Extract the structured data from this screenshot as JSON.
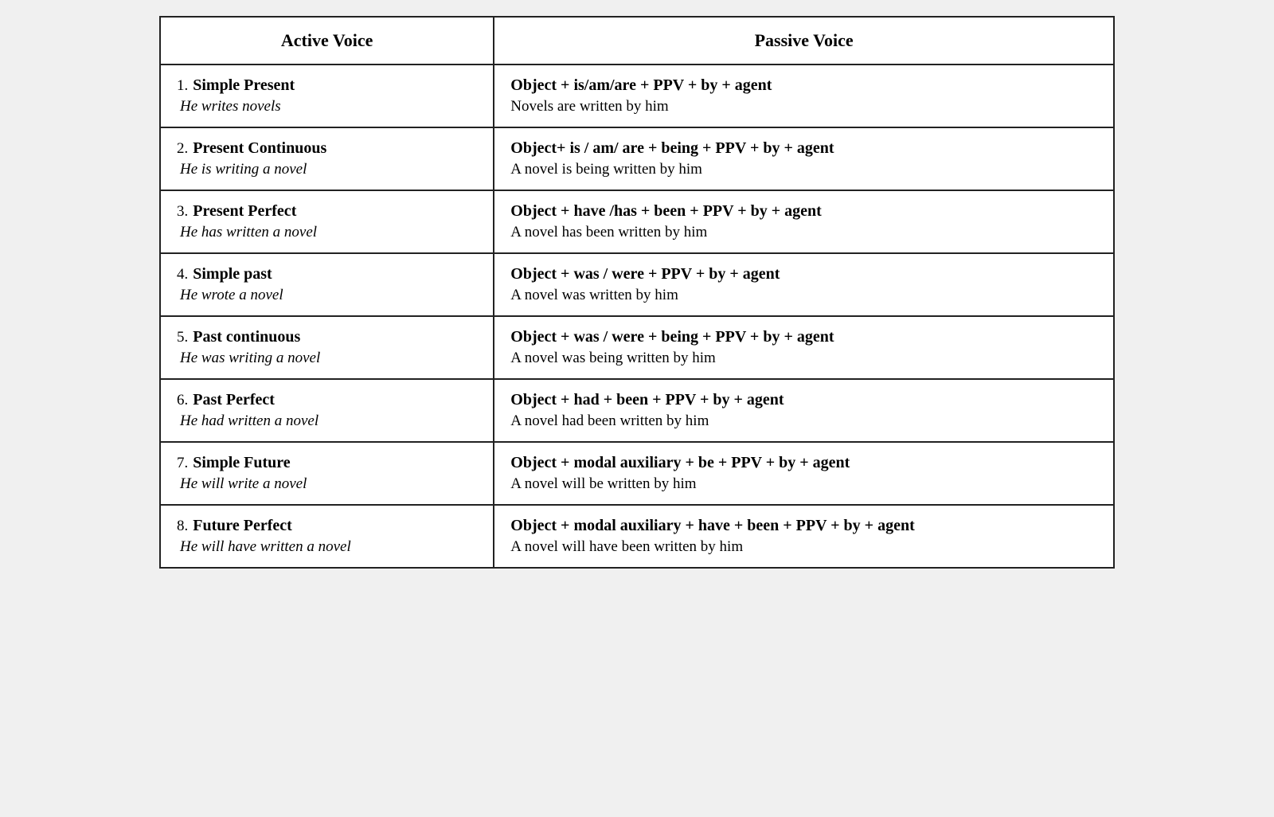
{
  "header": {
    "active": "Active Voice",
    "passive": "Passive Voice"
  },
  "rows": [
    {
      "num": "1.",
      "tense": "Simple Present",
      "active_example": "He writes novels",
      "passive_formula": "Object + is/am/are + PPV + by + agent",
      "passive_example": "Novels are written by him"
    },
    {
      "num": "2.",
      "tense": "Present Continuous",
      "active_example": "He is writing a novel",
      "passive_formula": "Object+ is / am/ are + being + PPV + by + agent",
      "passive_example": "A novel is being written by him"
    },
    {
      "num": "3.",
      "tense": "Present Perfect",
      "active_example": "He has written a novel",
      "passive_formula": "Object + have /has + been + PPV + by + agent",
      "passive_example": "A novel has been written by him"
    },
    {
      "num": "4.",
      "tense": "Simple past",
      "active_example": "He wrote a novel",
      "passive_formula": "Object + was / were + PPV + by + agent",
      "passive_example": "A novel was written by him"
    },
    {
      "num": "5.",
      "tense": "Past continuous",
      "active_example": "He was writing a novel",
      "passive_formula": "Object + was / were + being + PPV + by + agent",
      "passive_example": "A novel was  being written by him"
    },
    {
      "num": "6.",
      "tense": "Past Perfect",
      "active_example": "He had written a novel",
      "passive_formula": "Object + had + been + PPV + by + agent",
      "passive_example": "A novel had been written by him"
    },
    {
      "num": "7.",
      "tense": "Simple Future",
      "active_example": "He will write a novel",
      "passive_formula": "Object + modal auxiliary + be + PPV + by + agent",
      "passive_example": "A novel will be written by him"
    },
    {
      "num": "8.",
      "tense": "Future Perfect",
      "active_example": "He will have written a novel",
      "passive_formula": "Object + modal auxiliary +  have + been + PPV + by + agent",
      "passive_example": "A novel will have been written by him"
    }
  ]
}
